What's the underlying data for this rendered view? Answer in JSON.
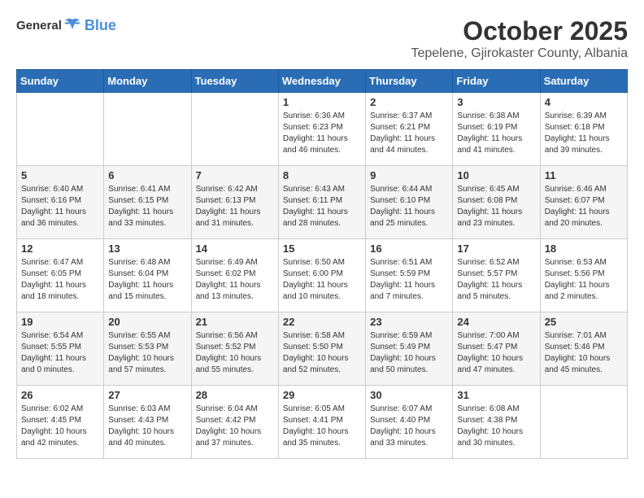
{
  "logo": {
    "general": "General",
    "blue": "Blue"
  },
  "header": {
    "title": "October 2025",
    "subtitle": "Tepelene, Gjirokaster County, Albania"
  },
  "weekdays": [
    "Sunday",
    "Monday",
    "Tuesday",
    "Wednesday",
    "Thursday",
    "Friday",
    "Saturday"
  ],
  "weeks": [
    [
      {
        "day": "",
        "info": ""
      },
      {
        "day": "",
        "info": ""
      },
      {
        "day": "",
        "info": ""
      },
      {
        "day": "1",
        "info": "Sunrise: 6:36 AM\nSunset: 6:23 PM\nDaylight: 11 hours\nand 46 minutes."
      },
      {
        "day": "2",
        "info": "Sunrise: 6:37 AM\nSunset: 6:21 PM\nDaylight: 11 hours\nand 44 minutes."
      },
      {
        "day": "3",
        "info": "Sunrise: 6:38 AM\nSunset: 6:19 PM\nDaylight: 11 hours\nand 41 minutes."
      },
      {
        "day": "4",
        "info": "Sunrise: 6:39 AM\nSunset: 6:18 PM\nDaylight: 11 hours\nand 39 minutes."
      }
    ],
    [
      {
        "day": "5",
        "info": "Sunrise: 6:40 AM\nSunset: 6:16 PM\nDaylight: 11 hours\nand 36 minutes."
      },
      {
        "day": "6",
        "info": "Sunrise: 6:41 AM\nSunset: 6:15 PM\nDaylight: 11 hours\nand 33 minutes."
      },
      {
        "day": "7",
        "info": "Sunrise: 6:42 AM\nSunset: 6:13 PM\nDaylight: 11 hours\nand 31 minutes."
      },
      {
        "day": "8",
        "info": "Sunrise: 6:43 AM\nSunset: 6:11 PM\nDaylight: 11 hours\nand 28 minutes."
      },
      {
        "day": "9",
        "info": "Sunrise: 6:44 AM\nSunset: 6:10 PM\nDaylight: 11 hours\nand 25 minutes."
      },
      {
        "day": "10",
        "info": "Sunrise: 6:45 AM\nSunset: 6:08 PM\nDaylight: 11 hours\nand 23 minutes."
      },
      {
        "day": "11",
        "info": "Sunrise: 6:46 AM\nSunset: 6:07 PM\nDaylight: 11 hours\nand 20 minutes."
      }
    ],
    [
      {
        "day": "12",
        "info": "Sunrise: 6:47 AM\nSunset: 6:05 PM\nDaylight: 11 hours\nand 18 minutes."
      },
      {
        "day": "13",
        "info": "Sunrise: 6:48 AM\nSunset: 6:04 PM\nDaylight: 11 hours\nand 15 minutes."
      },
      {
        "day": "14",
        "info": "Sunrise: 6:49 AM\nSunset: 6:02 PM\nDaylight: 11 hours\nand 13 minutes."
      },
      {
        "day": "15",
        "info": "Sunrise: 6:50 AM\nSunset: 6:00 PM\nDaylight: 11 hours\nand 10 minutes."
      },
      {
        "day": "16",
        "info": "Sunrise: 6:51 AM\nSunset: 5:59 PM\nDaylight: 11 hours\nand 7 minutes."
      },
      {
        "day": "17",
        "info": "Sunrise: 6:52 AM\nSunset: 5:57 PM\nDaylight: 11 hours\nand 5 minutes."
      },
      {
        "day": "18",
        "info": "Sunrise: 6:53 AM\nSunset: 5:56 PM\nDaylight: 11 hours\nand 2 minutes."
      }
    ],
    [
      {
        "day": "19",
        "info": "Sunrise: 6:54 AM\nSunset: 5:55 PM\nDaylight: 11 hours\nand 0 minutes."
      },
      {
        "day": "20",
        "info": "Sunrise: 6:55 AM\nSunset: 5:53 PM\nDaylight: 10 hours\nand 57 minutes."
      },
      {
        "day": "21",
        "info": "Sunrise: 6:56 AM\nSunset: 5:52 PM\nDaylight: 10 hours\nand 55 minutes."
      },
      {
        "day": "22",
        "info": "Sunrise: 6:58 AM\nSunset: 5:50 PM\nDaylight: 10 hours\nand 52 minutes."
      },
      {
        "day": "23",
        "info": "Sunrise: 6:59 AM\nSunset: 5:49 PM\nDaylight: 10 hours\nand 50 minutes."
      },
      {
        "day": "24",
        "info": "Sunrise: 7:00 AM\nSunset: 5:47 PM\nDaylight: 10 hours\nand 47 minutes."
      },
      {
        "day": "25",
        "info": "Sunrise: 7:01 AM\nSunset: 5:46 PM\nDaylight: 10 hours\nand 45 minutes."
      }
    ],
    [
      {
        "day": "26",
        "info": "Sunrise: 6:02 AM\nSunset: 4:45 PM\nDaylight: 10 hours\nand 42 minutes."
      },
      {
        "day": "27",
        "info": "Sunrise: 6:03 AM\nSunset: 4:43 PM\nDaylight: 10 hours\nand 40 minutes."
      },
      {
        "day": "28",
        "info": "Sunrise: 6:04 AM\nSunset: 4:42 PM\nDaylight: 10 hours\nand 37 minutes."
      },
      {
        "day": "29",
        "info": "Sunrise: 6:05 AM\nSunset: 4:41 PM\nDaylight: 10 hours\nand 35 minutes."
      },
      {
        "day": "30",
        "info": "Sunrise: 6:07 AM\nSunset: 4:40 PM\nDaylight: 10 hours\nand 33 minutes."
      },
      {
        "day": "31",
        "info": "Sunrise: 6:08 AM\nSunset: 4:38 PM\nDaylight: 10 hours\nand 30 minutes."
      },
      {
        "day": "",
        "info": ""
      }
    ]
  ]
}
